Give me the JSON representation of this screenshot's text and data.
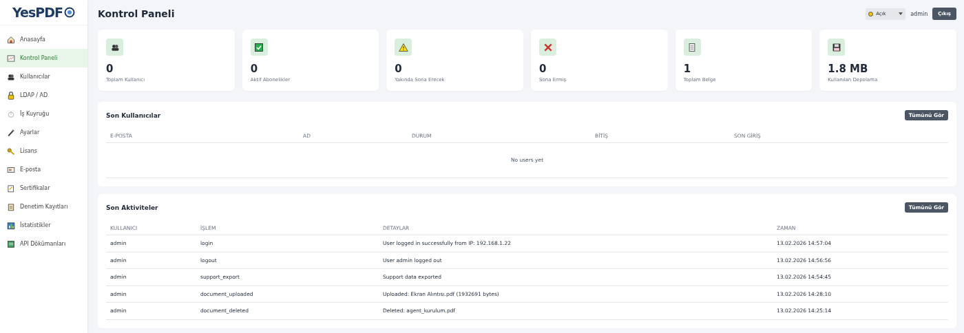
{
  "logo": {
    "text": "YesPDF"
  },
  "sidebar": {
    "items": [
      {
        "label": "Anasayfa",
        "selected": false
      },
      {
        "label": "Kontrol Paneli",
        "selected": true
      },
      {
        "label": "Kullanıcılar",
        "selected": false
      },
      {
        "label": "LDAP / AD",
        "selected": false
      },
      {
        "label": "İş Kuyruğu",
        "selected": false
      },
      {
        "label": "Ayarlar",
        "selected": false
      },
      {
        "label": "Lisans",
        "selected": false
      },
      {
        "label": "E-posta",
        "selected": false
      },
      {
        "label": "Sertifikalar",
        "selected": false
      },
      {
        "label": "Denetim Kayıtları",
        "selected": false
      },
      {
        "label": "İstatistikler",
        "selected": false
      },
      {
        "label": "API Dökümanları",
        "selected": false
      }
    ]
  },
  "header": {
    "title": "Kontrol Paneli",
    "theme": {
      "value": "Açık",
      "color": "#f5c400"
    },
    "user": "admin",
    "logout": "Çıkış"
  },
  "stats": [
    {
      "value": "0",
      "label": "Toplam Kullanıcı"
    },
    {
      "value": "0",
      "label": "Aktif Abonelikler"
    },
    {
      "value": "0",
      "label": "Yakında Sona Erecek"
    },
    {
      "value": "0",
      "label": "Sona Ermiş"
    },
    {
      "value": "1",
      "label": "Toplam Belge"
    },
    {
      "value": "1.8 MB",
      "label": "Kullanılan Depolama"
    }
  ],
  "recent_users": {
    "title": "Son Kullanıcılar",
    "button": "Tümünü Gör",
    "columns": [
      "E-POSTA",
      "AD",
      "DURUM",
      "BİTİŞ",
      "SON GİRİŞ"
    ],
    "empty": "No users yet"
  },
  "recent_activities": {
    "title": "Son Aktiviteler",
    "button": "Tümünü Gör",
    "columns": [
      "KULLANICI",
      "İŞLEM",
      "DETAYLAR",
      "ZAMAN"
    ],
    "rows": [
      [
        "admin",
        "login",
        "User logged in successfully from IP: 192.168.1.22",
        "13.02.2026 14:57:04"
      ],
      [
        "admin",
        "logout",
        "User admin logged out",
        "13.02.2026 14:56:56"
      ],
      [
        "admin",
        "support_export",
        "Support data exported",
        "13.02.2026 14:54:45"
      ],
      [
        "admin",
        "document_uploaded",
        "Uploaded: Ekran Alıntısı.pdf (1932691 bytes)",
        "13.02.2026 14:28:10"
      ],
      [
        "admin",
        "document_deleted",
        "Deleted: agent_kurulum.pdf",
        "13.02.2026 14:25:14"
      ]
    ]
  }
}
